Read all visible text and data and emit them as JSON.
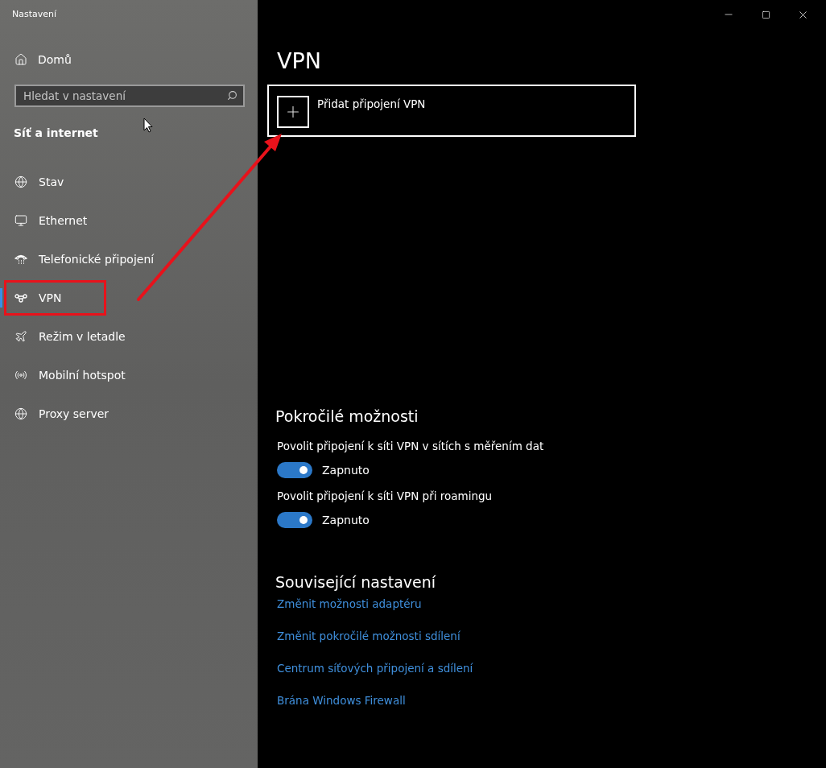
{
  "window": {
    "title": "Nastavení"
  },
  "sidebar": {
    "home": "Domů",
    "search": {
      "placeholder": "Hledat v nastavení"
    },
    "section": "Síť a internet",
    "items": [
      {
        "kind": "status",
        "label": "Stav",
        "selected": false,
        "highlighted": false
      },
      {
        "kind": "ethernet",
        "label": "Ethernet",
        "selected": false,
        "highlighted": false
      },
      {
        "kind": "dialup",
        "label": "Telefonické připojení",
        "selected": false,
        "highlighted": false
      },
      {
        "kind": "vpn",
        "label": "VPN",
        "selected": true,
        "highlighted": true
      },
      {
        "kind": "airplane",
        "label": "Režim v letadle",
        "selected": false,
        "highlighted": false
      },
      {
        "kind": "hotspot",
        "label": "Mobilní hotspot",
        "selected": false,
        "highlighted": false
      },
      {
        "kind": "proxy",
        "label": "Proxy server",
        "selected": false,
        "highlighted": false
      }
    ]
  },
  "main": {
    "title": "VPN",
    "add_connection": "Přidat připojení VPN",
    "advanced": {
      "heading": "Pokročilé možnosti",
      "toggles": [
        {
          "label": "Povolit připojení k síti VPN v sítích s měřením dat",
          "on": true,
          "state_text": "Zapnuto"
        },
        {
          "label": "Povolit připojení k síti VPN při roamingu",
          "on": true,
          "state_text": "Zapnuto"
        }
      ]
    },
    "related": {
      "heading": "Související nastavení",
      "links": [
        "Změnit možnosti adaptéru",
        "Změnit pokročilé možnosti sdílení",
        "Centrum síťových připojení a sdílení",
        "Brána Windows Firewall"
      ]
    }
  }
}
